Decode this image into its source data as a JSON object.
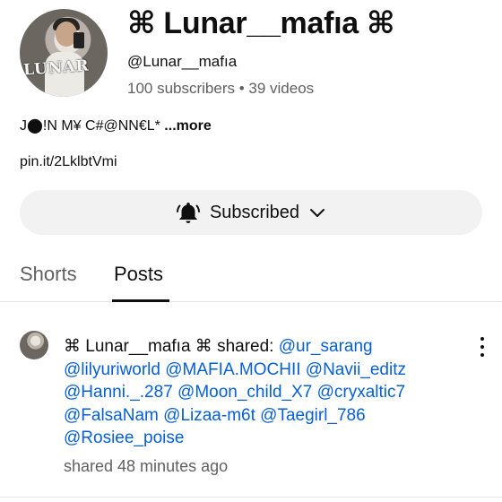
{
  "channel": {
    "name": "⌘ Lunar__mafıa ⌘",
    "handle": "@Lunar__mafıa",
    "meta": "100 subscribers • 39 videos",
    "description": "J⬤!N  M¥  C#@NN€L*",
    "more_label": " ...more",
    "link": "pin.it/2LklbtVmi",
    "avatar_mark": "LUNAR"
  },
  "subscribe": {
    "label": "Subscribed",
    "icon": "bell-ringing-icon",
    "dropdown_icon": "chevron-down-icon"
  },
  "tabs": [
    {
      "label": "Shorts",
      "selected": false
    },
    {
      "label": "Posts",
      "selected": true
    }
  ],
  "post": {
    "author_prefix": "⌘ Lunar__mafıa ⌘ shared: ",
    "mentions": [
      "@ur_sarang",
      "@lilyuriworld",
      "@MAFIA.MOCHII",
      "@Navii_editz",
      "@Hanni._.287",
      "@Moon_child_X7",
      "@cryxaltic7",
      "@FalsaNam",
      "@Lizaa-m6t",
      "@Taegirl_786",
      "@Rosiee_poise"
    ],
    "time": "shared 48 minutes ago",
    "menu_icon": "more-vertical-icon"
  },
  "colors": {
    "mention": "#065fd4",
    "secondary_text": "#606060",
    "button_bg": "#f2f2f2"
  }
}
